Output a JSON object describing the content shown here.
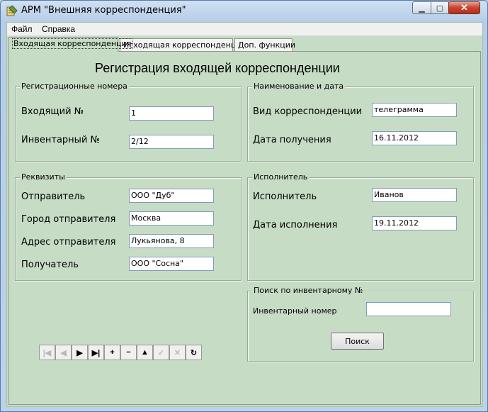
{
  "window": {
    "title": "АРМ \"Внешняя корреспонденция\""
  },
  "menu": {
    "file": "Файл",
    "help": "Справка"
  },
  "tabs": [
    {
      "label": "Входящая корреспонденция"
    },
    {
      "label": "Исходящая корреспонденция"
    },
    {
      "label": "Доп. функции"
    }
  ],
  "form": {
    "heading": "Регистрация входящей корреспонденции",
    "reg_numbers": {
      "title": "Регистрационные номера",
      "incoming_label": "Входящий №",
      "incoming_value": "1",
      "inventory_label": "Инвентарный №",
      "inventory_value": "2/12"
    },
    "name_date": {
      "title": "Наименование и дата",
      "type_label": "Вид корреспонденции",
      "type_value": "телеграмма",
      "date_label": "Дата получения",
      "date_value": "16.11.2012"
    },
    "details": {
      "title": "Реквизиты",
      "sender_label": "Отправитель",
      "sender_value": "ООО \"Дуб\"",
      "city_label": "Город отправителя",
      "city_value": "Москва",
      "address_label": "Адрес отправителя",
      "address_value": "Лукьянова, 8",
      "recipient_label": "Получатель",
      "recipient_value": "ООО \"Сосна\""
    },
    "executor": {
      "title": "Исполнитель",
      "executor_label": "Исполнитель",
      "executor_value": "Иванов",
      "date_label": "Дата исполнения",
      "date_value": "19.11.2012"
    },
    "search": {
      "title": "Поиск по инвентарному №",
      "label": "Инвентарный номер",
      "value": "",
      "button": "Поиск"
    }
  },
  "navigator": [
    {
      "icon": "|◀",
      "name": "first-record-button",
      "enabled": false
    },
    {
      "icon": "◀",
      "name": "prior-record-button",
      "enabled": false
    },
    {
      "icon": "▶",
      "name": "next-record-button",
      "enabled": true
    },
    {
      "icon": "▶|",
      "name": "last-record-button",
      "enabled": true
    },
    {
      "icon": "+",
      "name": "insert-record-button",
      "enabled": true
    },
    {
      "icon": "−",
      "name": "delete-record-button",
      "enabled": true
    },
    {
      "icon": "▲",
      "name": "edit-record-button",
      "enabled": true
    },
    {
      "icon": "✓",
      "name": "post-record-button",
      "enabled": false
    },
    {
      "icon": "✕",
      "name": "cancel-record-button",
      "enabled": false
    },
    {
      "icon": "↻",
      "name": "refresh-button",
      "enabled": true
    }
  ]
}
